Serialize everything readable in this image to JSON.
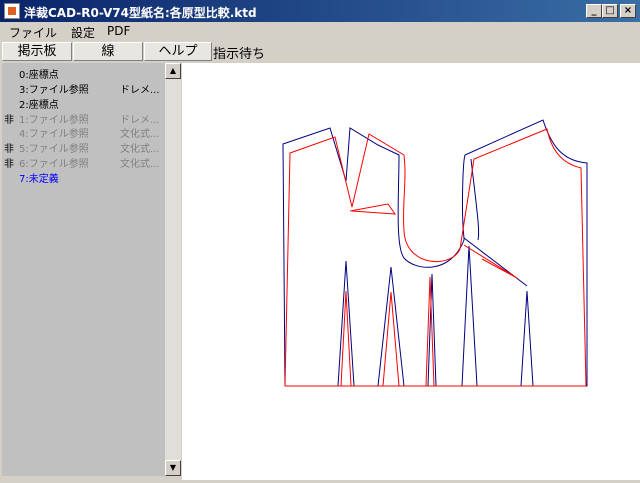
{
  "window": {
    "title": "洋裁CAD-R0-V74型紙名:各原型比較.ktd",
    "minimize_glyph": "_",
    "maximize_glyph": "□",
    "close_glyph": "×"
  },
  "menu": [
    "ファイル",
    "設定",
    "PDF"
  ],
  "toolbar": {
    "buttons": [
      "掲示板",
      "線",
      "ヘルプ"
    ],
    "status": "指示待ち"
  },
  "layers": [
    {
      "flag": "",
      "name": "0:座標点",
      "desc": "",
      "color": "#000000"
    },
    {
      "flag": "",
      "name": "3:ファイル参照",
      "desc": "ドレメ...",
      "color": "#000000"
    },
    {
      "flag": "",
      "name": "2:座標点",
      "desc": "",
      "color": "#000000"
    },
    {
      "flag": "非",
      "name": "1:ファイル参照",
      "desc": "ドレメ...",
      "color": "#808080"
    },
    {
      "flag": "",
      "name": "4:ファイル参照",
      "desc": "文化式...",
      "color": "#808080"
    },
    {
      "flag": "非",
      "name": "5:ファイル参照",
      "desc": "文化式...",
      "color": "#808080"
    },
    {
      "flag": "非",
      "name": "6:ファイル参照",
      "desc": "文化式...",
      "color": "#808080"
    },
    {
      "flag": "",
      "name": "7:未定義",
      "desc": "",
      "color": "#0000ff"
    }
  ],
  "scrollbar": {
    "up_glyph": "▲",
    "down_glyph": "▼"
  },
  "canvas": {
    "line_colors": {
      "pattern_a": "#000080",
      "pattern_b": "#ff0000"
    }
  }
}
